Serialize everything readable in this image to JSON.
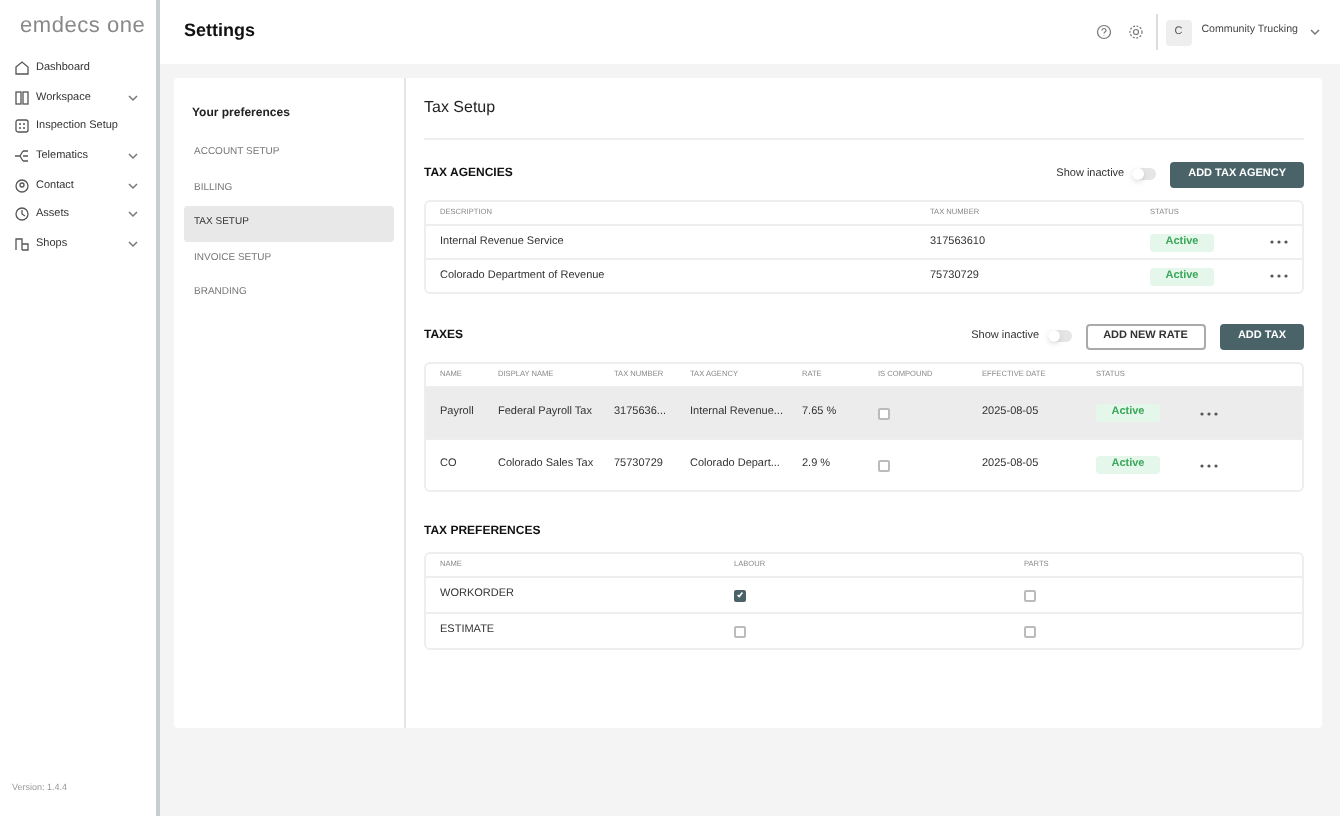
{
  "sidebar": {
    "logo": "emdecs one",
    "items": [
      {
        "label": "Dashboard",
        "has_submenu": false
      },
      {
        "label": "Workspace",
        "has_submenu": true
      },
      {
        "label": "Inspection Setup",
        "has_submenu": false
      },
      {
        "label": "Telematics",
        "has_submenu": true
      },
      {
        "label": "Contact",
        "has_submenu": true
      },
      {
        "label": "Assets",
        "has_submenu": true
      },
      {
        "label": "Shops",
        "has_submenu": true
      }
    ],
    "version": "Version: 1.4.4"
  },
  "header": {
    "title": "Settings",
    "avatar": "C",
    "company": "Community Trucking"
  },
  "preferences": {
    "heading": "Your preferences",
    "items": [
      {
        "label": "ACCOUNT SETUP",
        "selected": false
      },
      {
        "label": "BILLING",
        "selected": false
      },
      {
        "label": "TAX SETUP",
        "selected": true
      },
      {
        "label": "INVOICE SETUP",
        "selected": false
      },
      {
        "label": "BRANDING",
        "selected": false
      }
    ]
  },
  "page_title": "Tax Setup",
  "tax_agencies": {
    "title": "TAX AGENCIES",
    "show_inactive": {
      "label": "Show inactive",
      "on": false
    },
    "buttons": [
      {
        "label": "ADD TAX AGENCY",
        "kind": "primary"
      }
    ],
    "columns": [
      "DESCRIPTION",
      "TAX NUMBER",
      "STATUS"
    ],
    "rows": [
      {
        "description": "Internal Revenue Service",
        "tax_number": "317563610",
        "status": "Active"
      },
      {
        "description": "Colorado Department of Revenue",
        "tax_number": "75730729",
        "status": "Active"
      }
    ]
  },
  "taxes": {
    "title": "TAXES",
    "show_inactive": {
      "label": "Show inactive",
      "on": false
    },
    "buttons": [
      {
        "label": "ADD NEW RATE",
        "kind": "outline"
      },
      {
        "label": "ADD TAX",
        "kind": "primary"
      }
    ],
    "columns": [
      "NAME",
      "DISPLAY NAME",
      "TAX NUMBER",
      "TAX AGENCY",
      "RATE",
      "IS COMPOUND",
      "EFFECTIVE DATE",
      "STATUS"
    ],
    "rows": [
      {
        "name": "Payroll",
        "display_name": "Federal Payroll Tax",
        "tax_number": "3175636...",
        "tax_agency": "Internal Revenue...",
        "rate": "7.65 %",
        "is_compound": false,
        "effective_date": "2025-08-05",
        "status": "Active",
        "selected": true
      },
      {
        "name": "CO",
        "display_name": "Colorado Sales Tax",
        "tax_number": "75730729",
        "tax_agency": "Colorado Depart...",
        "rate": "2.9 %",
        "is_compound": false,
        "effective_date": "2025-08-05",
        "status": "Active",
        "selected": false
      }
    ]
  },
  "tax_preferences": {
    "title": "TAX PREFERENCES",
    "columns": [
      "NAME",
      "LABOUR",
      "PARTS"
    ],
    "rows": [
      {
        "name": "WORKORDER",
        "labour": true,
        "parts": false
      },
      {
        "name": "ESTIMATE",
        "labour": false,
        "parts": false
      }
    ]
  }
}
